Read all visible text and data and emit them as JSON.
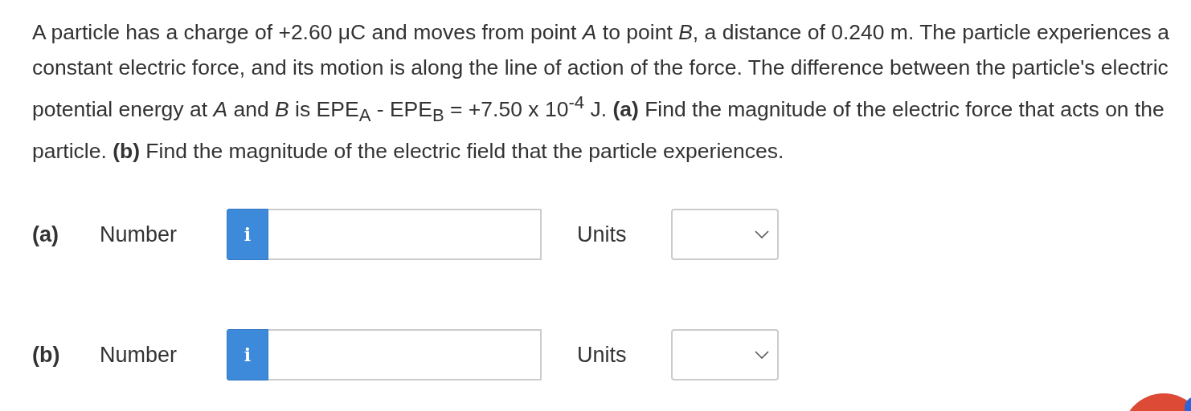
{
  "question": "A particle has a charge of +2.60 μC and moves from point *A* to point *B*, a distance of 0.240 m. The particle experiences a constant electric force, and its motion is along the line of action of the force. The difference between the particle's electric potential energy at *A* and *B* is EPE$_{A}$ - EPE$_{B}$ = +7.50 x 10$^{-4}$ J. **(a)** Find the magnitude of the electric force that acts on the particle. **(b)** Find the magnitude of the electric field that the particle experiences.",
  "answers": [
    {
      "part": "(a)",
      "label": "Number",
      "info": "i",
      "units_label": "Units"
    },
    {
      "part": "(b)",
      "label": "Number",
      "info": "i",
      "units_label": "Units"
    }
  ]
}
